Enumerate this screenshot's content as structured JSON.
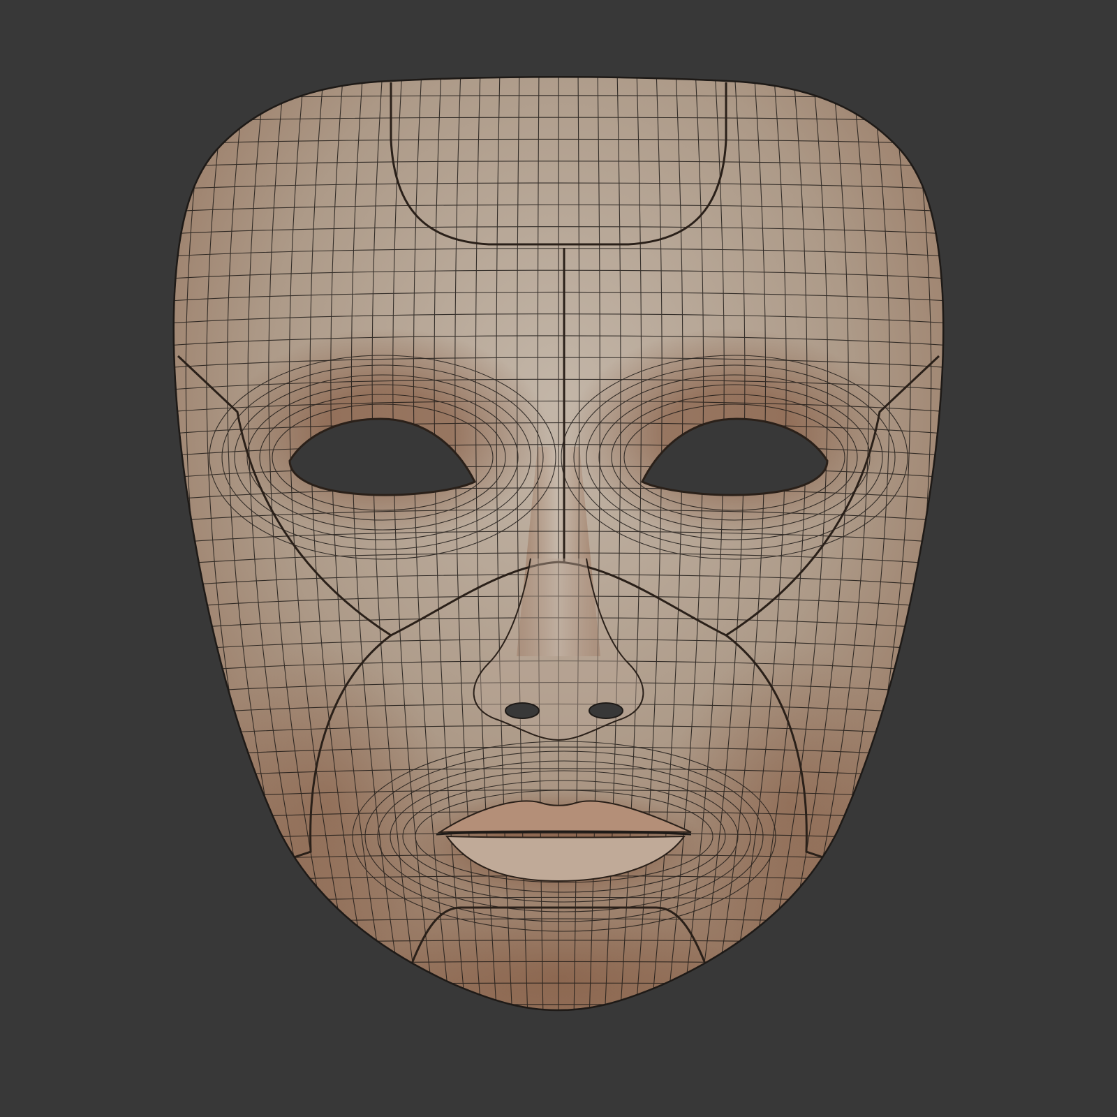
{
  "scene": {
    "subject_icon": "face-mask-icon",
    "render_style": "clay-render-with-quad-wireframe",
    "colors": {
      "background": "#383838",
      "clay_light": "#c5b8aa",
      "clay_mid": "#a89482",
      "clay_shadow": "#8a5a3e",
      "wire": "#1e1a17",
      "hole": "#383838"
    }
  }
}
